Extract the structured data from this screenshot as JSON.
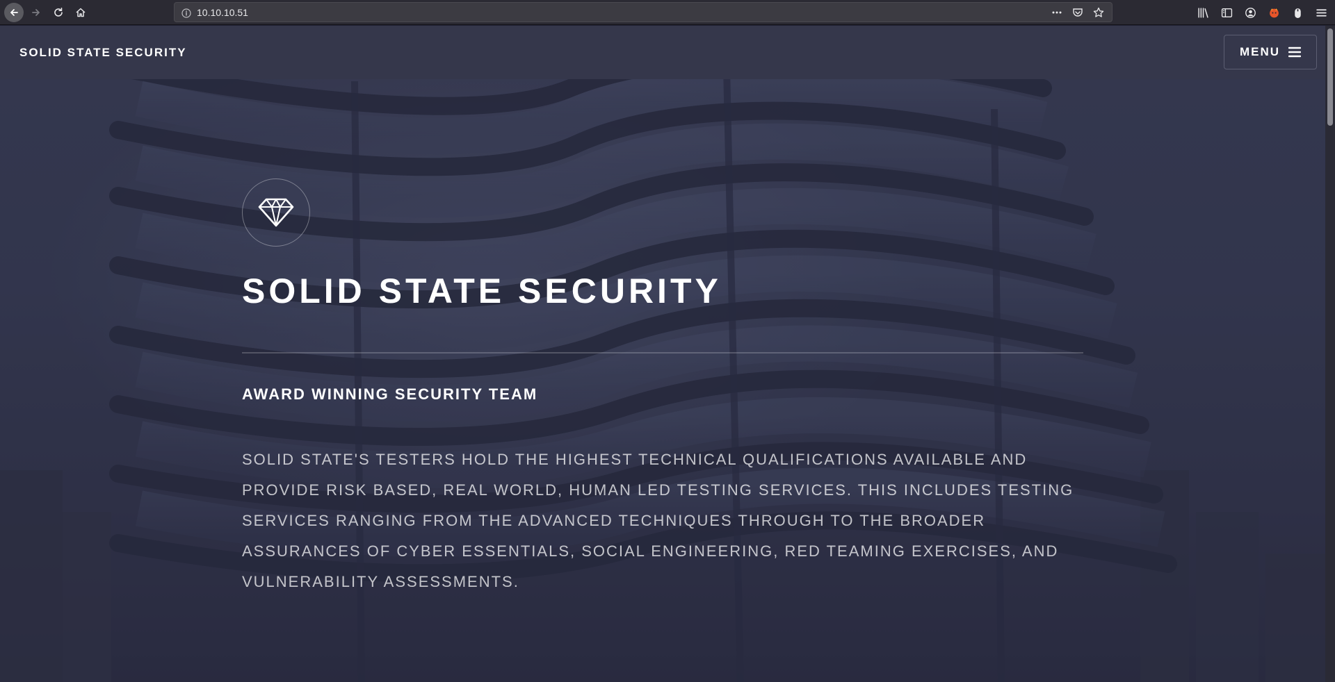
{
  "browser": {
    "url": "10.10.10.51",
    "icons": {
      "back": "back-arrow-icon",
      "forward": "forward-arrow-icon",
      "reload": "reload-icon",
      "home": "home-icon",
      "info": "info-icon",
      "page_actions": "more-dots-icon",
      "pocket": "pocket-icon",
      "bookmark": "star-icon",
      "library": "library-icon",
      "sidebar": "sidebar-icon",
      "account": "account-icon",
      "extension": "firefox-extension-icon",
      "privacy": "privacy-icon",
      "app_menu": "hamburger-icon"
    }
  },
  "site": {
    "logo_text": "SOLID STATE SECURITY",
    "menu_label": "MENU"
  },
  "hero": {
    "title": "SOLID STATE SECURITY",
    "subtitle": "AWARD WINNING SECURITY TEAM",
    "description": "SOLID STATE'S TESTERS HOLD THE HIGHEST TECHNICAL QUALIFICATIONS AVAILABLE AND PROVIDE RISK BASED, REAL WORLD, HUMAN LED TESTING SERVICES. THIS INCLUDES TESTING SERVICES RANGING FROM THE ADVANCED TECHNIQUES THROUGH TO THE BROADER ASSURANCES OF CYBER ESSENTIALS, SOCIAL ENGINEERING, RED TEAMING EXERCISES, AND VULNERABILITY ASSESSMENTS.",
    "logo_icon": "diamond-icon"
  },
  "colors": {
    "chrome_bg": "#2b2a33",
    "header_bg": "#35374b",
    "hero_bg": "#353a52",
    "text": "#ffffff"
  }
}
